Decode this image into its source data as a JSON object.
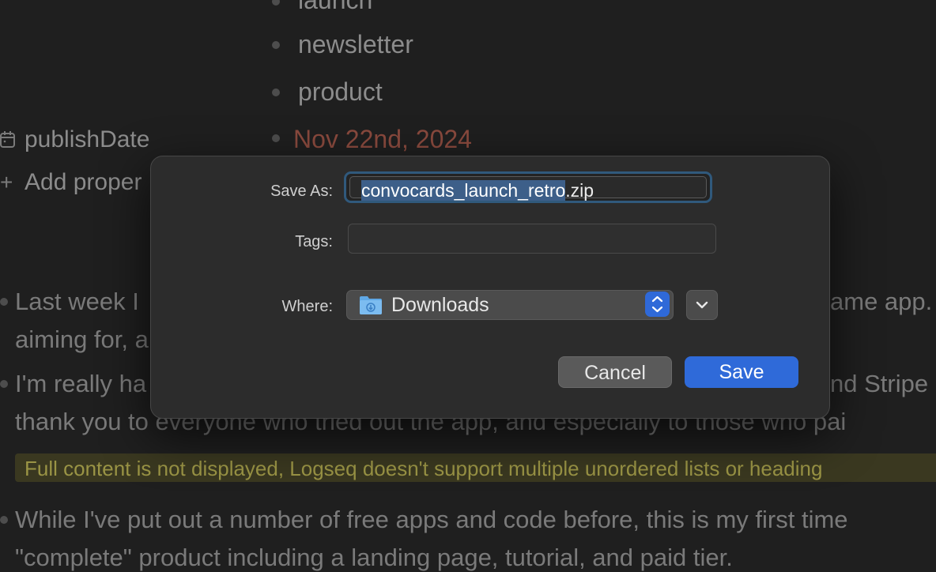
{
  "background": {
    "tags": [
      "launch",
      "newsletter",
      "product"
    ],
    "date_value": "Nov 22nd, 2024",
    "properties": {
      "publish_date_label": "publishDate",
      "add_property_label": "Add proper"
    },
    "paragraphs": [
      {
        "line1": "Last week I",
        "line1_right": "ame app.",
        "line2": "aiming for, a"
      },
      {
        "line1": "I'm really ha",
        "line1_right": "nd Stripe",
        "line2": "thank you to everyone who tried out the app, and especially to those who pai"
      }
    ],
    "warning": "Full content is not displayed, Logseq doesn't support multiple unordered lists or heading",
    "paragraph3": {
      "line1": "While I've put out a number of free apps and code before, this is my first time",
      "line2": "\"complete\" product including a landing page, tutorial, and paid tier."
    }
  },
  "dialog": {
    "save_as_label": "Save As:",
    "filename_selected": "convocards_launch_retro",
    "filename_ext": ".zip",
    "tags_label": "Tags:",
    "tags_value": "",
    "where_label": "Where:",
    "where_value": "Downloads",
    "cancel_label": "Cancel",
    "save_label": "Save"
  },
  "icons": {
    "calendar": "calendar-icon",
    "plus": "plus-icon",
    "folder": "downloads-folder-icon",
    "stepper": "updown-chevron-icon",
    "expand": "chevron-down-icon"
  },
  "colors": {
    "accent": "#2f6ad9",
    "focus_ring": "#30597c",
    "selection": "#3d5f89",
    "date": "#8a4a3e"
  }
}
